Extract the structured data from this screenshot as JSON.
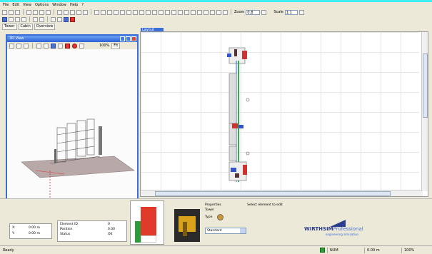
{
  "menu": [
    "File",
    "Edit",
    "View",
    "Options",
    "Window",
    "Help",
    "?"
  ],
  "toolbar": {
    "zoom_label": "Zoom",
    "zoom_value": "0.8",
    "scale_label": "Scale",
    "scale_value": "1:1",
    "row2": [
      "Tower",
      "Cabin",
      "Overview"
    ]
  },
  "window3d": {
    "title": "3D View",
    "zoom_readout": "100%",
    "btn": "Fit"
  },
  "main": {
    "tab": "Layout"
  },
  "bottom": {
    "coords_left": [
      "X:",
      "Y:"
    ],
    "coords_right": [
      "0.00 m",
      "0.00 m"
    ],
    "info_lines": [
      "Element ID",
      "Position",
      "Status"
    ],
    "info_values": [
      "0",
      "0.00",
      "OK"
    ],
    "props_title": "Properties",
    "props_name": "Tower",
    "props_label": "Type",
    "props_select": "Standard",
    "hint": "Select element to edit",
    "brand_main": "WIRTHSIM",
    "brand_suffix": "Professional",
    "brand_tag": "engineering simulation"
  },
  "statusbar": {
    "left": "Ready",
    "c1": "NUM",
    "c2": "0.00 m",
    "c3": "100%"
  },
  "colors": {
    "accent": "#3a6ed8",
    "gauge_red": "#e03a2a",
    "gauge_green": "#2e9b3a"
  }
}
